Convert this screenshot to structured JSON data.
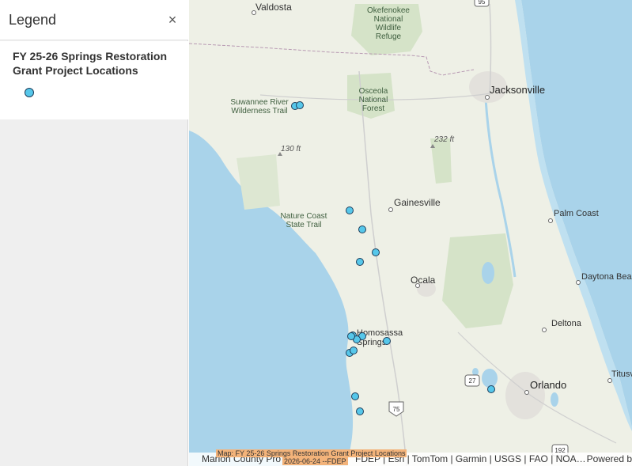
{
  "legend": {
    "title": "Legend",
    "close_glyph": "×",
    "layer_title": "FY 25-26 Springs Restoration Grant Project Locations"
  },
  "map": {
    "cities": [
      {
        "name": "Valdosta"
      },
      {
        "name": "Jacksonville"
      },
      {
        "name": "Gainesville"
      },
      {
        "name": "Palm Coast"
      },
      {
        "name": "Ocala"
      },
      {
        "name": "Daytona Beac"
      },
      {
        "name": "Deltona"
      },
      {
        "name": "Orlando"
      },
      {
        "name": "Titusv"
      },
      {
        "name": "Homosassa Springs"
      }
    ],
    "parks": [
      {
        "name": "Okefenokee National Wildlife Refuge"
      },
      {
        "name": "Osceola National Forest"
      },
      {
        "name": "Suwannee River Wilderness Trail"
      },
      {
        "name": "Nature Coast State Trail"
      }
    ],
    "elevations": [
      "130 ft",
      "232 ft"
    ],
    "shields": [
      "95",
      "27",
      "75",
      "192"
    ],
    "project_count": 16
  },
  "attribution": {
    "left": "Marion County Pro",
    "sources": "FDEP | Esri | TomTom | Garmin | USGS | FAO | NOA…",
    "powered": "Powered b"
  },
  "tooltip": {
    "line1": "Map: FY 25-26 Springs Restoration Grant Project Locations",
    "line2": "2026-06-24 --FDEP"
  },
  "colors": {
    "land": "#eef0e6",
    "water": "#a9d3ea",
    "forest": "#d5e3c8",
    "project_fill": "#56c7ea",
    "project_stroke": "#1d3d5a",
    "tooltip_bg": "#f3b37a"
  }
}
